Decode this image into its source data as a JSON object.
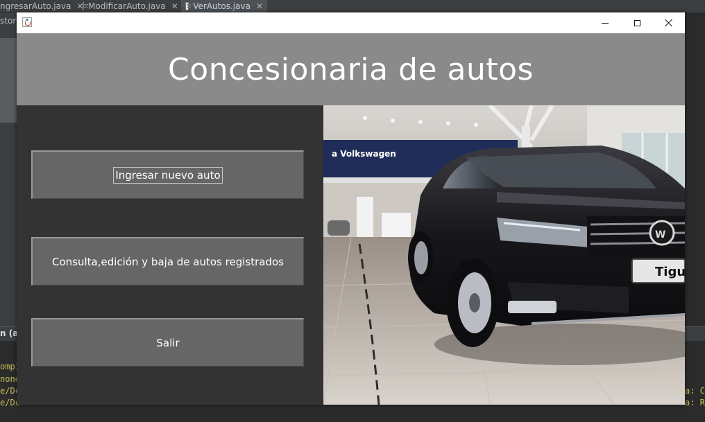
{
  "ide": {
    "tabs": [
      {
        "label": "ngresarAuto.java",
        "active": false
      },
      {
        "label": "ModificarAuto.java",
        "active": false
      },
      {
        "label": "VerAutos.java",
        "active": true
      }
    ],
    "tab_close": "✕",
    "left_strip_label": "story",
    "output_tab_label": "n (au",
    "console_lines": [
      "ompi",
      "none",
      "e/Dc",
      "e/Dc"
    ],
    "console_right_lines": [
      "a: C",
      "a: R"
    ]
  },
  "window": {
    "header_title": "Concesionaria de autos",
    "buttons": {
      "add": "Ingresar nuevo auto",
      "manage": "Consulta,edición y baja de autos registrados",
      "exit": "Salir"
    },
    "photo": {
      "banner_text": "a Volkswagen",
      "plate_text": "Tigua"
    }
  },
  "colors": {
    "header_bg": "#8a8a8a",
    "panel_bg": "#333333",
    "button_bg": "#666666",
    "ide_bg": "#2b2b2b",
    "console_text": "#c7c05a"
  }
}
